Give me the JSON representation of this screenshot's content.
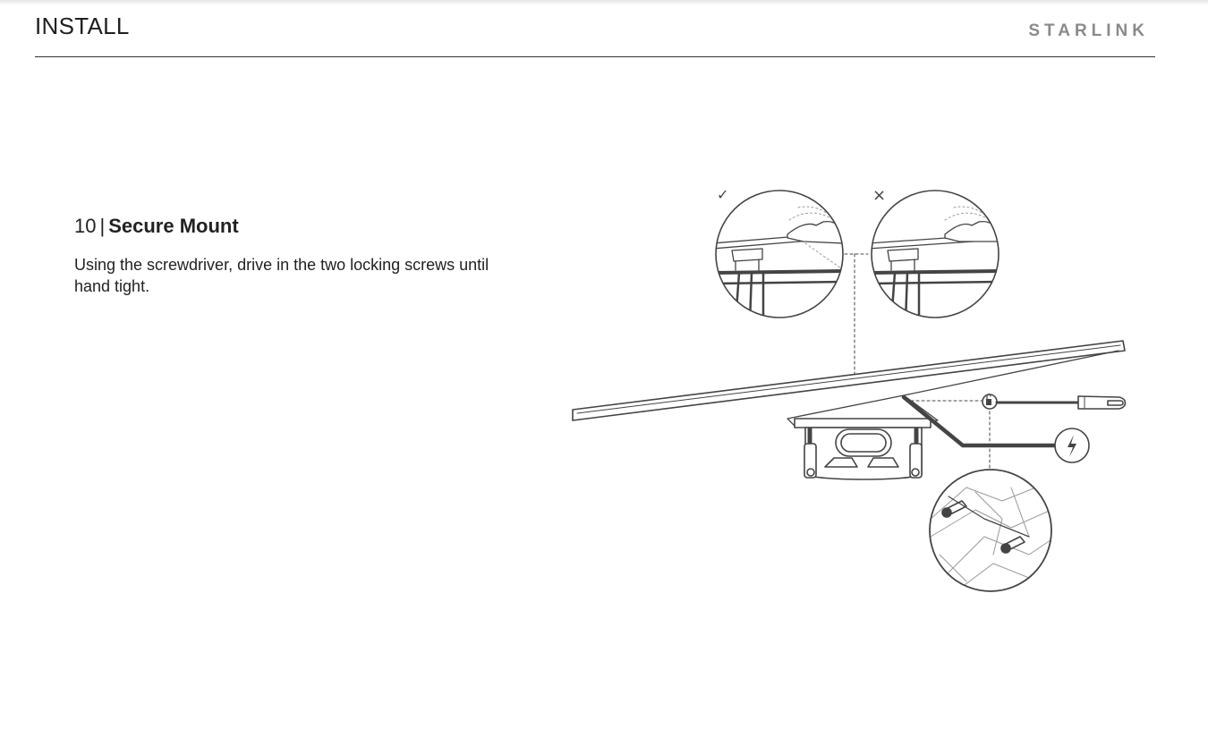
{
  "header": {
    "section": "INSTALL",
    "brand": "STARLINK"
  },
  "step": {
    "number": "10",
    "separator": "|",
    "title": "Secure Mount",
    "description": "Using the screwdriver, drive in the two locking screws until hand tight."
  },
  "figure": {
    "correct_mark": "✓",
    "incorrect_mark": "×"
  },
  "colors": {
    "line": "#444444",
    "brand": "#8a8a8a",
    "text": "#222222"
  }
}
